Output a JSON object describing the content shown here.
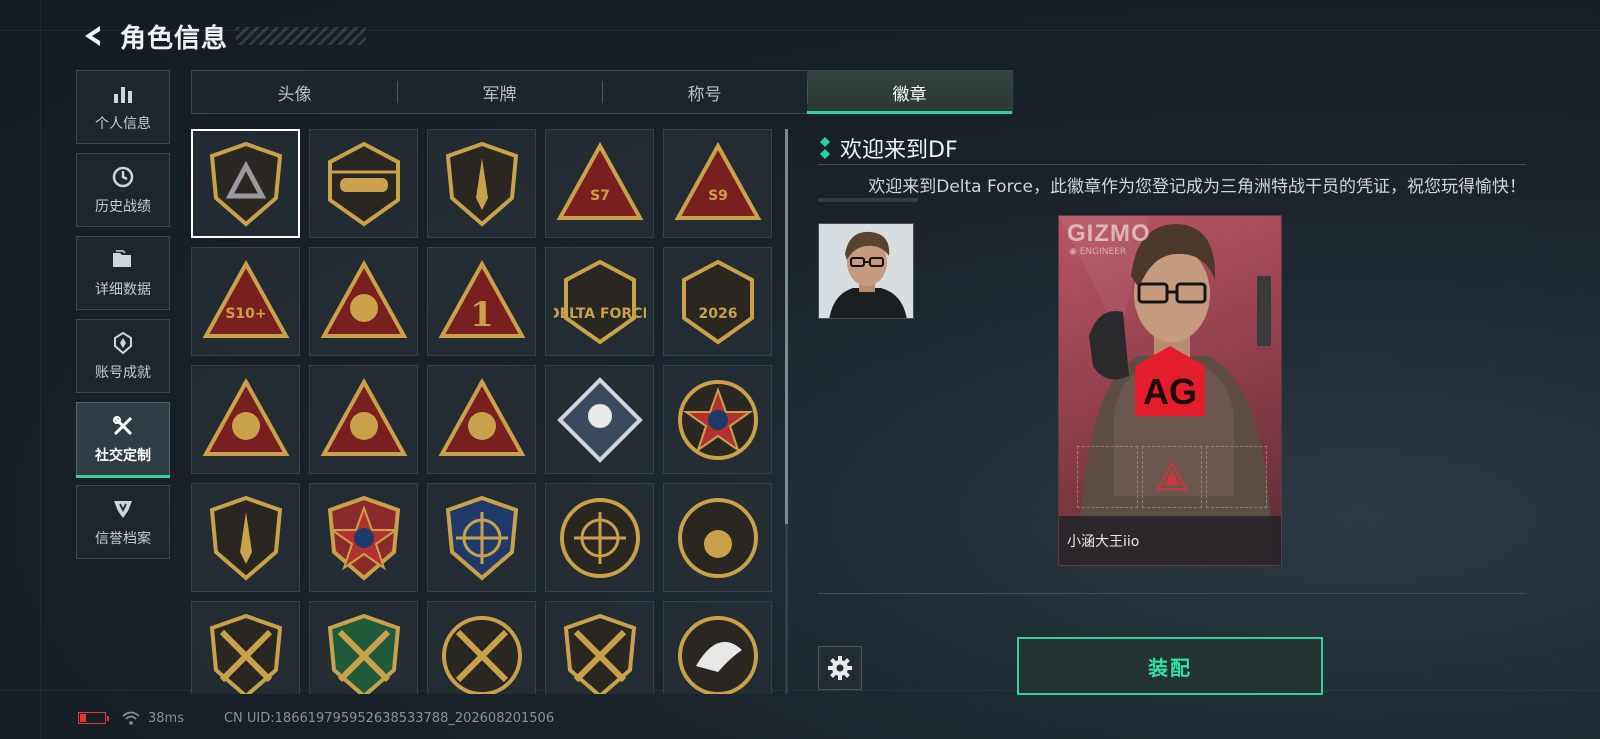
{
  "header": {
    "title": "角色信息"
  },
  "sidebar": {
    "items": [
      {
        "label": "个人信息",
        "icon": "bar-chart-icon",
        "active": false
      },
      {
        "label": "历史战绩",
        "icon": "clock-icon",
        "active": false
      },
      {
        "label": "详细数据",
        "icon": "folder-icon",
        "active": false
      },
      {
        "label": "账号成就",
        "icon": "achievement-icon",
        "active": false
      },
      {
        "label": "社交定制",
        "icon": "tools-icon",
        "active": true
      },
      {
        "label": "信誉档案",
        "icon": "shield-icon",
        "active": false
      }
    ]
  },
  "tabs": [
    {
      "label": "头像",
      "active": false
    },
    {
      "label": "军牌",
      "active": false
    },
    {
      "label": "称号",
      "active": false
    },
    {
      "label": "徽章",
      "active": true
    }
  ],
  "badges": [
    {
      "name": "delta-shield-badge",
      "selected": true
    },
    {
      "name": "helicopter-badge"
    },
    {
      "name": "dagger-shield-badge"
    },
    {
      "name": "s7-triangle-badge",
      "text": "S7"
    },
    {
      "name": "s9-triangle-badge",
      "text": "S9"
    },
    {
      "name": "s10-triangle-badge",
      "text": "S10+"
    },
    {
      "name": "fruit-triangle-badge"
    },
    {
      "name": "number-one-badge",
      "text": "1"
    },
    {
      "name": "delta-force-2025-badge",
      "text": "DELTA FORCE"
    },
    {
      "name": "delta-force-2026-badge",
      "text": "2026"
    },
    {
      "name": "usb-triangle-badge"
    },
    {
      "name": "dice-triangle-badge"
    },
    {
      "name": "soldiers-triangle-badge"
    },
    {
      "name": "rose-diamond-badge"
    },
    {
      "name": "star-emblem-badge"
    },
    {
      "name": "crest-shield-badge"
    },
    {
      "name": "star-shield-gold-badge"
    },
    {
      "name": "star-shield-blue-badge"
    },
    {
      "name": "crosshair-skull-badge"
    },
    {
      "name": "skull-round-badge"
    },
    {
      "name": "crossed-rifles-badge"
    },
    {
      "name": "green-rifle-badge"
    },
    {
      "name": "sniper-round-badge"
    },
    {
      "name": "crossed-rifles-gold-badge"
    },
    {
      "name": "eagle-round-badge"
    }
  ],
  "detail": {
    "title": "欢迎来到DF",
    "description": "欢迎来到Delta Force，此徽章作为您登记成为三角洲特战干员的凭证，祝您玩得愉快！"
  },
  "card": {
    "brand": "GIZMO",
    "subtitle": "◉ ENGINEER",
    "logo": "AG",
    "player_name": "小涵大王iio"
  },
  "actions": {
    "equip_label": "装配"
  },
  "status": {
    "ping": "38ms",
    "uid": "CN UID:18661979595263853378​8_202608201506"
  },
  "colors": {
    "accent": "#2fd39a",
    "gold": "#c9a14a",
    "badge_red": "#7a1f1f"
  }
}
